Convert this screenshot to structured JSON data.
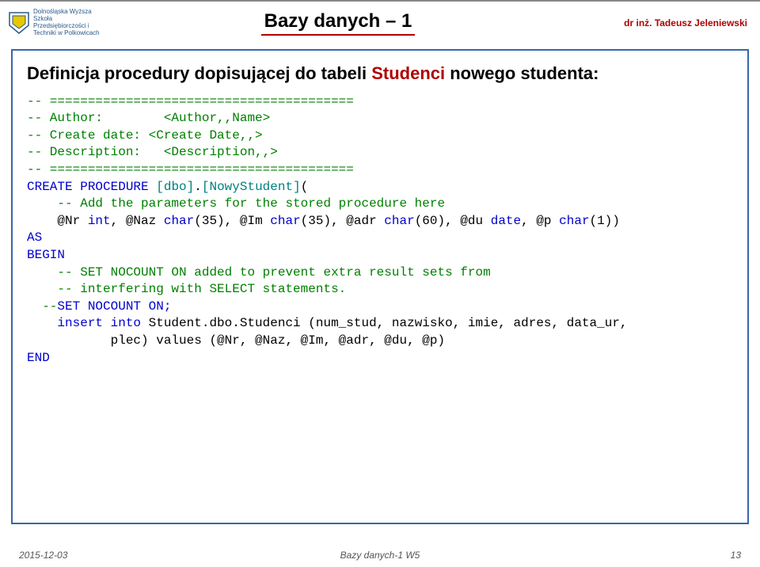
{
  "header": {
    "logo_text": "Dolnośląska Wyższa Szkoła Przedsiębiorczości i Techniki w Polkowicach",
    "course_title": "Bazy danych – 1",
    "author": "dr inż. Tadeusz Jeleniewski"
  },
  "heading": {
    "pre": "Definicja procedury dopisującej do tabeli ",
    "hi": "Studenci",
    "post": " nowego studenta:"
  },
  "code": {
    "l01": "-- ========================================",
    "l02": "-- Author:        <Author,,Name>",
    "l03": "-- Create date: <Create Date,,>",
    "l04": "-- Description:   <Description,,>",
    "l05": "-- ========================================",
    "l06a": "CREATE PROCEDURE ",
    "l06b": "[dbo]",
    "l06c": ".",
    "l06d": "[NowyStudent]",
    "l06e": "(",
    "l07": "    -- Add the parameters for the stored procedure here",
    "l08a": "    @Nr ",
    "l08b": "int",
    "l08c": ", @Naz ",
    "l08d": "char",
    "l08e": "(35), @Im ",
    "l08f": "char",
    "l08g": "(35), @adr ",
    "l08h": "char",
    "l08i": "(60), @du ",
    "l08j": "date",
    "l08k": ", @p ",
    "l08l": "char",
    "l08m": "(1))",
    "l09": "AS",
    "l10": "BEGIN",
    "l11": "    -- SET NOCOUNT ON added to prevent extra result sets from",
    "l12": "    -- interfering with SELECT statements.",
    "l13a": "  --",
    "l13b": "SET NOCOUNT ON;",
    "l14a": "    insert into ",
    "l14b": "Student.dbo.Studenci ",
    "l14c": "(num_stud, nazwisko, imie, adres, data_ur,",
    "l15": "           plec) values (@Nr, @Naz, @Im, @adr, @du, @p)",
    "l16": "END"
  },
  "footer": {
    "date": "2015-12-03",
    "center": "Bazy danych-1 W5",
    "page": "13"
  }
}
